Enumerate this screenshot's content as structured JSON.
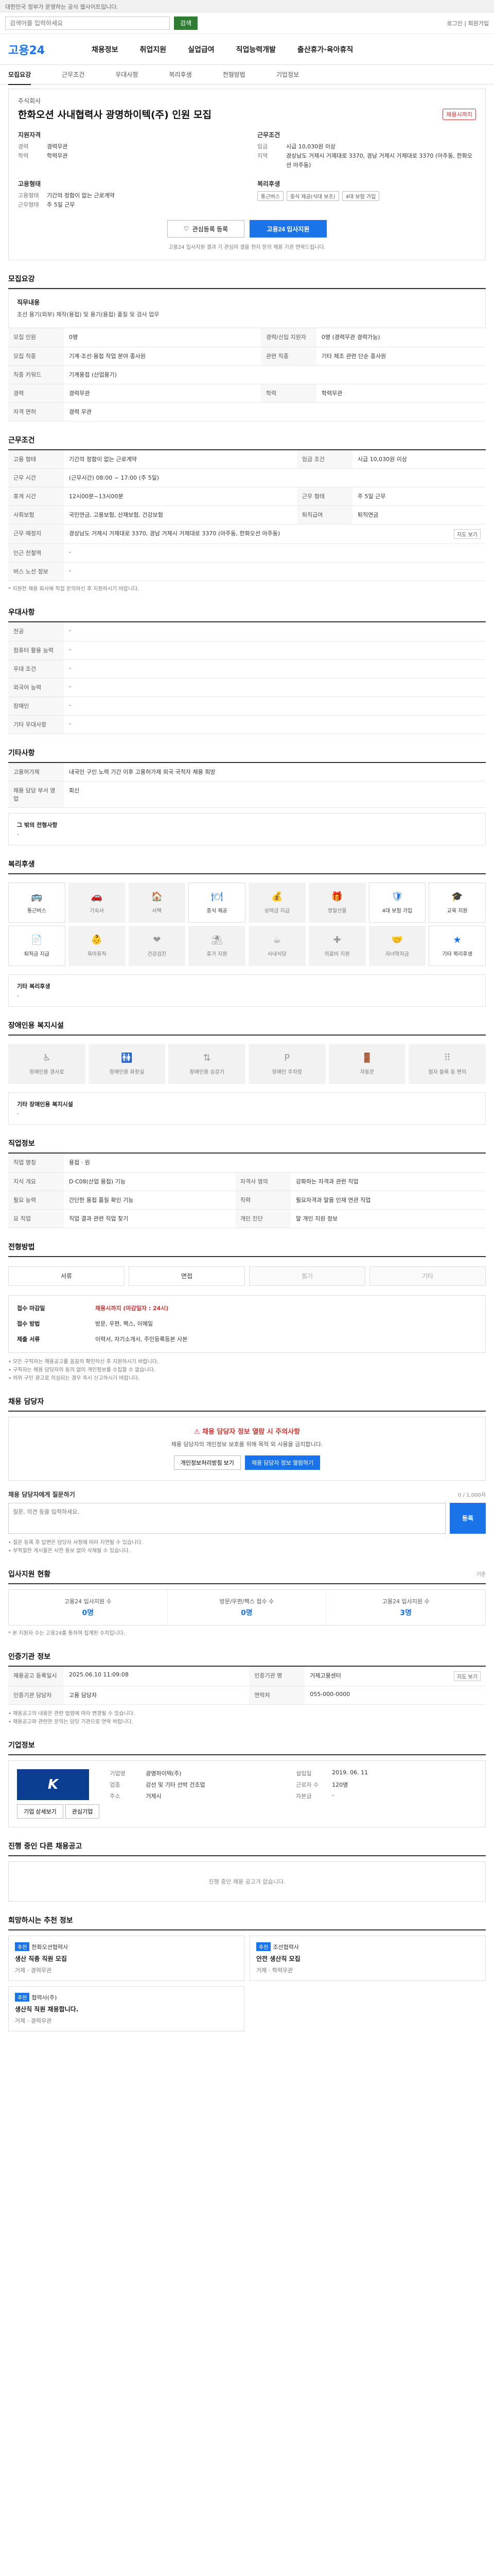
{
  "topbar": {
    "text": "대한민국 정부가 운영하는 공식 웹사이트입니다."
  },
  "search": {
    "placeholder": "검색어를 입력하세요",
    "button": "검색",
    "right": "로그인 | 회원가입"
  },
  "header": {
    "logo": "고용24",
    "nav": [
      "채용정보",
      "취업지원",
      "실업급여",
      "직업능력개발",
      "출산휴가·육아휴직"
    ]
  },
  "subnav": [
    "모집요강",
    "근무조건",
    "우대사항",
    "복리후생",
    "전형방법",
    "기업정보"
  ],
  "job": {
    "company": "주식회사",
    "title": "한화오션 사내협력사 광명하이텍(주) 인원 모집",
    "badge": "채용시까지",
    "groups": [
      {
        "title": "지원자격",
        "rows": [
          {
            "k": "경력",
            "v": "경력무관"
          },
          {
            "k": "학력",
            "v": "학력무관"
          }
        ]
      },
      {
        "title": "근무조건",
        "rows": [
          {
            "k": "임금",
            "v": "시급 10,030원 이상"
          },
          {
            "k": "지역",
            "v": "경상남도 거제시 거제대로 3370, 경남 거제시 거제대로 3370 (아주동, 한화오션 아주동)"
          }
        ]
      },
      {
        "title": "고용형태",
        "rows": [
          {
            "k": "고용형태",
            "v": "기간의 정함이 없는 근로계약"
          },
          {
            "k": "근무형태",
            "v": "주 5일 근무"
          }
        ]
      }
    ],
    "welfare_title": "복리후생",
    "welfare_chips": [
      "통근버스",
      "중식 제공(식대 보조)",
      "4대 보험 가입"
    ],
    "save_btn": "관심등록 등록",
    "apply_btn": "고용24 입사지원",
    "notice": "고용24 입사지원 결과 기 관심이 결을 현지 문의 채용 기관 연락드립니다."
  },
  "recruit": {
    "section": "모집요강",
    "desc_title": "직무내용",
    "desc": "조선 용기(외부) 제작(용접) 및 용기(용접) 품질 및 검사 업무",
    "rows": [
      {
        "k": "모집 인원",
        "v": "0명",
        "k2": "경력/신입 지원자",
        "v2": "0명 (경력무관 경력가능)"
      },
      {
        "k": "모집 직종",
        "v": "기계·조선·용접 작업 분야 종사원",
        "k2": "관련 직종",
        "v2": "기타 제조 관련 단순 종사원"
      },
      {
        "k": "직종 키워드",
        "v": "기계용접 (산업용기)",
        "k2": "",
        "v2": ""
      },
      {
        "k": "경력",
        "v": "경력무관",
        "k2": "학력",
        "v2": "학력무관"
      },
      {
        "k": "자격 면허",
        "v": "경력 무관",
        "k2": "",
        "v2": ""
      }
    ]
  },
  "condition": {
    "section": "근무조건",
    "rows": [
      {
        "k": "고용 형태",
        "v": "기간의 정함이 없는 근로계약",
        "k2": "임금 조건",
        "v2": "시급 10,030원 이상"
      },
      {
        "k": "근무 시간",
        "v": "(근무시간) 08:00 ~ 17:00 (주 5일)",
        "k2": "",
        "v2": ""
      },
      {
        "k": "휴게 시간",
        "v": "12시00분~13시00분",
        "k2": "근무 형태",
        "v2": "주 5일 근무"
      },
      {
        "k": "사회보험",
        "v": "국민연금, 고용보험, 산재보험, 건강보험",
        "k2": "퇴직급여",
        "v2": "퇴직연금"
      },
      {
        "k": "근무 예정지",
        "v": "경상남도 거제시 거제대로 3370, 경남 거제시 거제대로 3370 (아주동, 한화오션 아주동)",
        "k2": "",
        "v2": ""
      },
      {
        "k": "인근 전철역",
        "v": "-",
        "k2": "",
        "v2": ""
      },
      {
        "k": "버스 노선 정보",
        "v": "-",
        "k2": "",
        "v2": ""
      }
    ],
    "map_btn": "지도 보기",
    "footnote": "* 지원전 채용 회사에 직접 문의하신 후 지원하시기 바랍니다."
  },
  "preference": {
    "section": "우대사항",
    "rows": [
      {
        "k": "전공",
        "v": "-"
      },
      {
        "k": "컴퓨터 활용 능력",
        "v": "-"
      },
      {
        "k": "우대 조건",
        "v": "-"
      },
      {
        "k": "외국어 능력",
        "v": "-"
      },
      {
        "k": "장애인",
        "v": "-"
      },
      {
        "k": "기타 우대사항",
        "v": "-"
      }
    ]
  },
  "other": {
    "section": "기타사항",
    "rows": [
      {
        "k": "고용허가제",
        "v": "내국인 구인 노력 기간 이후 고용허가제 외국 국적자 채용 희망"
      },
      {
        "k": "채용 담당 부서 영업",
        "v": "회신"
      }
    ],
    "box_label": "그 밖의 전형사항",
    "box_value": "-"
  },
  "welfare": {
    "section": "복리후생",
    "items": [
      {
        "icon": "bus-icon",
        "glyph": "🚌",
        "label": "통근버스",
        "on": true
      },
      {
        "icon": "car-icon",
        "glyph": "🚗",
        "label": "기숙사",
        "on": false
      },
      {
        "icon": "house-icon",
        "glyph": "🏠",
        "label": "사택",
        "on": false
      },
      {
        "icon": "meal-icon",
        "glyph": "🍽",
        "label": "중식 제공",
        "on": true
      },
      {
        "icon": "money-icon",
        "glyph": "💰",
        "label": "상여금 지급",
        "on": false
      },
      {
        "icon": "gift-icon",
        "glyph": "🎁",
        "label": "명절선물",
        "on": false
      },
      {
        "icon": "shield-icon",
        "glyph": "🛡",
        "label": "4대 보험 가입",
        "on": true
      },
      {
        "icon": "grad-icon",
        "glyph": "🎓",
        "label": "교육 지원",
        "on": true
      },
      {
        "icon": "doc-icon",
        "glyph": "📄",
        "label": "퇴직금 지급",
        "on": true
      },
      {
        "icon": "child-icon",
        "glyph": "👶",
        "label": "육아휴직",
        "on": false
      },
      {
        "icon": "health-icon",
        "glyph": "❤",
        "label": "건강검진",
        "on": false
      },
      {
        "icon": "rest-icon",
        "glyph": "⛱",
        "label": "휴가 지원",
        "on": false
      },
      {
        "icon": "coffee-icon",
        "glyph": "☕",
        "label": "사내식당",
        "on": false
      },
      {
        "icon": "plus-icon",
        "glyph": "✚",
        "label": "의료비 지원",
        "on": false
      },
      {
        "icon": "hand-icon",
        "glyph": "🤝",
        "label": "자녀학자금",
        "on": false
      },
      {
        "icon": "star-icon",
        "glyph": "★",
        "label": "기타 복리후생",
        "on": true
      }
    ],
    "box_label": "기타 복리후생",
    "box_value": "-"
  },
  "disability": {
    "section": "장애인용 복지시설",
    "items": [
      {
        "icon": "ramp-icon",
        "glyph": "♿",
        "label": "장애인용 경사로"
      },
      {
        "icon": "toilet-icon",
        "glyph": "🚻",
        "label": "장애인용 화장실"
      },
      {
        "icon": "elevator-icon",
        "glyph": "⇅",
        "label": "장애인용 승강기"
      },
      {
        "icon": "parking-icon",
        "glyph": "P",
        "label": "장애인 주차장"
      },
      {
        "icon": "door-icon",
        "glyph": "🚪",
        "label": "자동문"
      },
      {
        "icon": "braille-icon",
        "glyph": "⠿",
        "label": "점자 블록 등 편의"
      }
    ],
    "box_label": "기타 장애인용 복지시설",
    "box_value": "-"
  },
  "jobinfo": {
    "section": "직업정보",
    "rows": [
      {
        "k": "직업 명칭",
        "v": "용접 · 원",
        "k2": "",
        "v2": ""
      },
      {
        "k": "지식 개요",
        "v": "D·C08(산업 용접) 기능",
        "k2": "자격사 영의",
        "v2": "강화하는 자격과 관련 직업"
      },
      {
        "k": "필요 능력",
        "v": "간단한 용접 품질 확인 기능",
        "k2": "직력",
        "v2": "필요자격과 말을 인재 연관 직업"
      },
      {
        "k": "요 직업",
        "v": "직업 결과 관련 직업 찾기",
        "k2": "개인 진단",
        "v2": "말 개인 지원 정보"
      }
    ]
  },
  "selection": {
    "section": "전형방법",
    "steps": [
      {
        "label": "서류",
        "off": false
      },
      {
        "label": "면접",
        "off": false
      },
      {
        "label": "필기",
        "off": true
      },
      {
        "label": "기타",
        "off": true
      }
    ],
    "apply_rows": [
      {
        "k": "접수 마감일",
        "v": "채용시까지 (마감일자 : 24시)"
      },
      {
        "k": "접수 방법",
        "v": "방문, 우편, 팩스, 이메일"
      },
      {
        "k": "제출 서류",
        "v": "이력서, 자기소개서, 주민등록등본 사본"
      }
    ],
    "notes": [
      "• 모든 구직자는 채용공고를 꼼꼼히 확인하신 후 지원하시기 바랍니다.",
      "• 구직자는 채용 담당자의 동의 없이 개인정보를 수집할 수 없습니다.",
      "• 허위 구인 광고로 의심되는 경우 즉시 신고하시기 바랍니다."
    ]
  },
  "contact": {
    "section": "채용 담당자",
    "warn_title": "채용 담당자 정보 열람 시 주의사항",
    "warn_text": "채용 담당자의 개인정보 보호를 위해 목적 외 사용을 금지합니다.",
    "btn1": "개인정보처리방침 보기",
    "btn2": "채용 담당자 정보 열람하기",
    "qna_label": "채용 담당자에게 질문하기",
    "qna_count": "0 / 1,000자",
    "qna_placeholder": "질문, 의견 등을 입력하세요.",
    "qna_btn": "등록",
    "notes": [
      "• 질문 등록 후 답변은 담당자 사정에 따라 지연될 수 있습니다.",
      "• 부적절한 게시물은 사전 통보 없이 삭제될 수 있습니다."
    ]
  },
  "applicants": {
    "section": "입사지원 현황",
    "unit": "기준",
    "stats": [
      {
        "k": "고용24 입사지원 수",
        "v": "0명"
      },
      {
        "k": "방문/우편/팩스 접수 수",
        "v": "0명"
      },
      {
        "k": "고용24 입사지원 수",
        "v": "3명"
      }
    ],
    "footnote": "* 본 지원자 수는 고용24를 통하여 집계된 수치입니다."
  },
  "org": {
    "section": "인증기관 정보",
    "rows": [
      {
        "k": "채용공고 등록일시",
        "v": "2025.06.10 11:09:08",
        "k2": "인증기관 명",
        "v2": "거제고용센터"
      },
      {
        "k": "인증기관 담당자",
        "v": "고용 담당자",
        "k2": "연락처",
        "v2": "055-000-0000"
      }
    ],
    "btn": "지도 보기",
    "notes": [
      "• 채용공고의 내용은 관련 법령에 따라 변경될 수 있습니다.",
      "• 채용공고와 관련한 문의는 담당 기관으로 연락 바랍니다."
    ]
  },
  "corp": {
    "section": "기업정보",
    "logo": "K",
    "rows": [
      {
        "k": "기업명",
        "v": "광명하이텍(주)",
        "k2": "설립일",
        "v2": "2019. 06. 11"
      },
      {
        "k": "업종",
        "v": "강선 및 기타 선박 건조업",
        "k2": "근로자 수",
        "v2": "120명"
      },
      {
        "k": "주소",
        "v": "거제시",
        "k2": "자본금",
        "v2": "-"
      }
    ],
    "btn1": "기업 상세보기",
    "btn2": "관심기업"
  },
  "other_jobs": {
    "section": "진행 중인 다른 채용공고",
    "empty": "진행 중인 채용 공고가 없습니다."
  },
  "recommend": {
    "section": "희망하시는 추천 정보",
    "cards": [
      {
        "tag": "추천",
        "company": "한화오션협력사",
        "title": "생산 직종 직원 모집",
        "meta": "거제 · 경력무관"
      },
      {
        "tag": "추천",
        "company": "조선협력사",
        "title": "안전 생산직 모집",
        "meta": "거제 · 학력무관"
      },
      {
        "tag": "추천",
        "company": "협력사(주)",
        "title": "생산직 직원 채용합니다.",
        "meta": "거제 · 경력무관"
      }
    ]
  }
}
